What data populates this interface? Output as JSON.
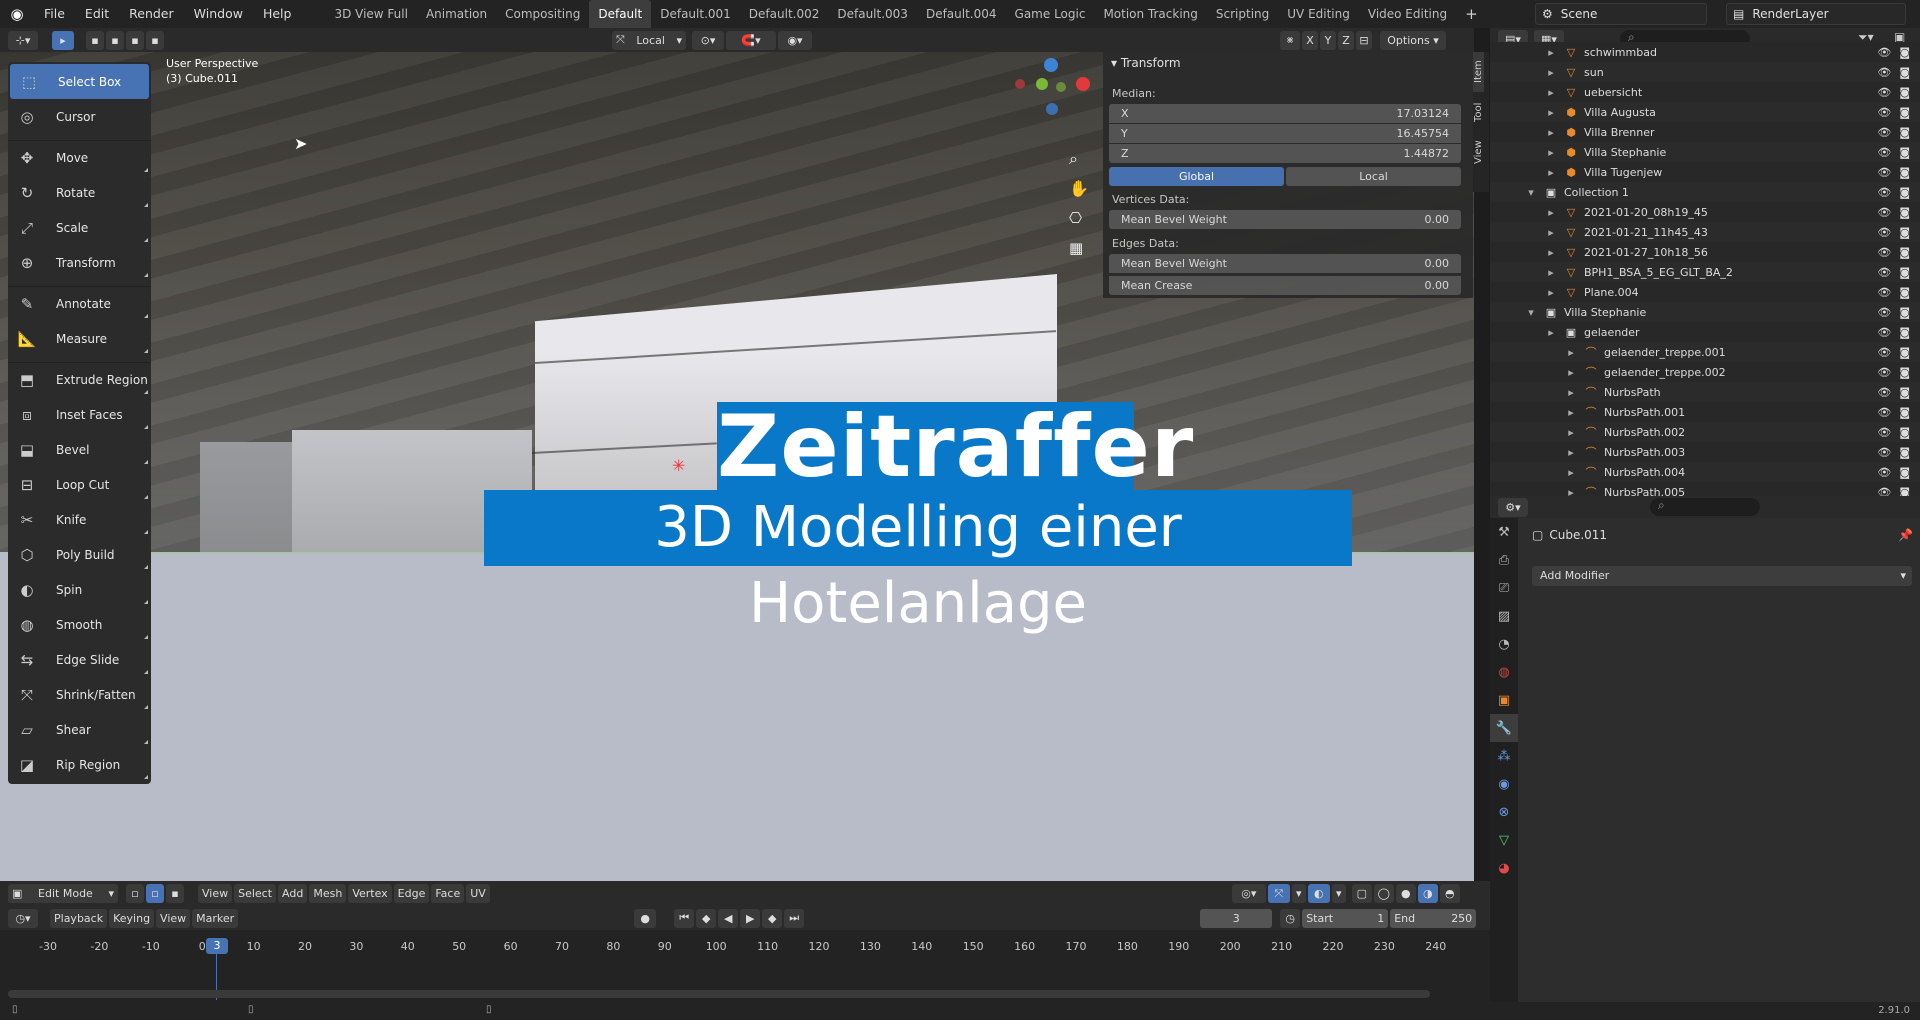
{
  "topbar": {
    "menus": [
      "File",
      "Edit",
      "Render",
      "Window",
      "Help"
    ],
    "workspaces": [
      "3D View Full",
      "Animation",
      "Compositing",
      "Default",
      "Default.001",
      "Default.002",
      "Default.003",
      "Default.004",
      "Game Logic",
      "Motion Tracking",
      "Scripting",
      "UV Editing",
      "Video Editing"
    ],
    "active_workspace": "Default",
    "scene": "Scene",
    "view_layer": "RenderLayer"
  },
  "viewport_header": {
    "transform_orientation": "Local",
    "axes": [
      "X",
      "Y",
      "Z"
    ],
    "options": "Options"
  },
  "viewport": {
    "perspective": "User Perspective",
    "object": "(3) Cube.011",
    "gizmo_colors": {
      "x": "#e23a3a",
      "y": "#7ab935",
      "z": "#3d84d6"
    }
  },
  "overlay_title": {
    "line1": "Zeitraffer",
    "line2": "3D Modelling einer Hotelanlage",
    "bg": "#0a78c8"
  },
  "toolbar": {
    "tools": [
      {
        "label": "Select Box",
        "icon": "select-box-icon",
        "active": true
      },
      {
        "label": "Cursor",
        "icon": "cursor-icon"
      },
      {
        "label": "Move",
        "icon": "move-icon"
      },
      {
        "label": "Rotate",
        "icon": "rotate-icon"
      },
      {
        "label": "Scale",
        "icon": "scale-icon"
      },
      {
        "label": "Transform",
        "icon": "transform-icon"
      },
      {
        "label": "Annotate",
        "icon": "annotate-icon"
      },
      {
        "label": "Measure",
        "icon": "measure-icon"
      },
      {
        "label": "Extrude Region",
        "icon": "extrude-icon"
      },
      {
        "label": "Inset Faces",
        "icon": "inset-icon"
      },
      {
        "label": "Bevel",
        "icon": "bevel-icon"
      },
      {
        "label": "Loop Cut",
        "icon": "loop-cut-icon"
      },
      {
        "label": "Knife",
        "icon": "knife-icon"
      },
      {
        "label": "Poly Build",
        "icon": "poly-build-icon"
      },
      {
        "label": "Spin",
        "icon": "spin-icon"
      },
      {
        "label": "Smooth",
        "icon": "smooth-icon"
      },
      {
        "label": "Edge Slide",
        "icon": "edge-slide-icon"
      },
      {
        "label": "Shrink/Fatten",
        "icon": "shrink-fatten-icon"
      },
      {
        "label": "Shear",
        "icon": "shear-icon"
      },
      {
        "label": "Rip Region",
        "icon": "rip-icon"
      }
    ]
  },
  "npanel": {
    "section": "Transform",
    "median_label": "Median:",
    "x_label": "X",
    "x": "17.03124",
    "y_label": "Y",
    "y": "16.45754",
    "z_label": "Z",
    "z": "1.44872",
    "global": "Global",
    "local": "Local",
    "vertices_data": "Vertices Data:",
    "mean_bevel_weight": "Mean Bevel Weight",
    "vbw": "0.00",
    "edges_data": "Edges Data:",
    "ebw": "0.00",
    "mean_crease": "Mean Crease",
    "crease": "0.00",
    "tabs": [
      "Item",
      "Tool",
      "View"
    ]
  },
  "footer": {
    "mode": "Edit Mode",
    "menus": [
      "View",
      "Select",
      "Add",
      "Mesh",
      "Vertex",
      "Edge",
      "Face",
      "UV"
    ]
  },
  "timeline": {
    "menus": [
      "Playback",
      "Keying",
      "View",
      "Marker"
    ],
    "current_frame": "3",
    "start_label": "Start",
    "start": "1",
    "end_label": "End",
    "end": "250",
    "ticks": [
      "-30",
      "-20",
      "-10",
      "0",
      "10",
      "20",
      "30",
      "40",
      "50",
      "60",
      "70",
      "80",
      "90",
      "100",
      "110",
      "120",
      "130",
      "140",
      "150",
      "160",
      "170",
      "180",
      "190",
      "200",
      "210",
      "220",
      "230",
      "240"
    ],
    "marker": "3"
  },
  "outliner": {
    "rows": [
      {
        "label": "schwimmbad",
        "indent": 2
      },
      {
        "label": "sun",
        "indent": 2
      },
      {
        "label": "uebersicht",
        "indent": 2
      },
      {
        "label": "Villa Augusta",
        "indent": 2
      },
      {
        "label": "Villa Brenner",
        "indent": 2
      },
      {
        "label": "Villa Stephanie",
        "indent": 2
      },
      {
        "label": "Villa Tugenjew",
        "indent": 2
      },
      {
        "label": "Collection 1",
        "indent": 1
      },
      {
        "label": "2021-01-20_08h19_45",
        "indent": 2
      },
      {
        "label": "2021-01-21_11h45_43",
        "indent": 2
      },
      {
        "label": "2021-01-27_10h18_56",
        "indent": 2
      },
      {
        "label": "BPH1_BSA_5_EG_GLT_BA_2",
        "indent": 2
      },
      {
        "label": "Plane.004",
        "indent": 2
      },
      {
        "label": "Villa Stephanie",
        "indent": 1
      },
      {
        "label": "gelaender",
        "indent": 2
      },
      {
        "label": "gelaender_treppe.001",
        "indent": 3
      },
      {
        "label": "gelaender_treppe.002",
        "indent": 3
      },
      {
        "label": "NurbsPath",
        "indent": 3
      },
      {
        "label": "NurbsPath.001",
        "indent": 3
      },
      {
        "label": "NurbsPath.002",
        "indent": 3
      },
      {
        "label": "NurbsPath.003",
        "indent": 3
      },
      {
        "label": "NurbsPath.004",
        "indent": 3
      },
      {
        "label": "NurbsPath.005",
        "indent": 3
      }
    ]
  },
  "properties": {
    "object": "Cube.011",
    "add_modifier": "Add Modifier"
  },
  "status": {
    "version": "2.91.0"
  }
}
